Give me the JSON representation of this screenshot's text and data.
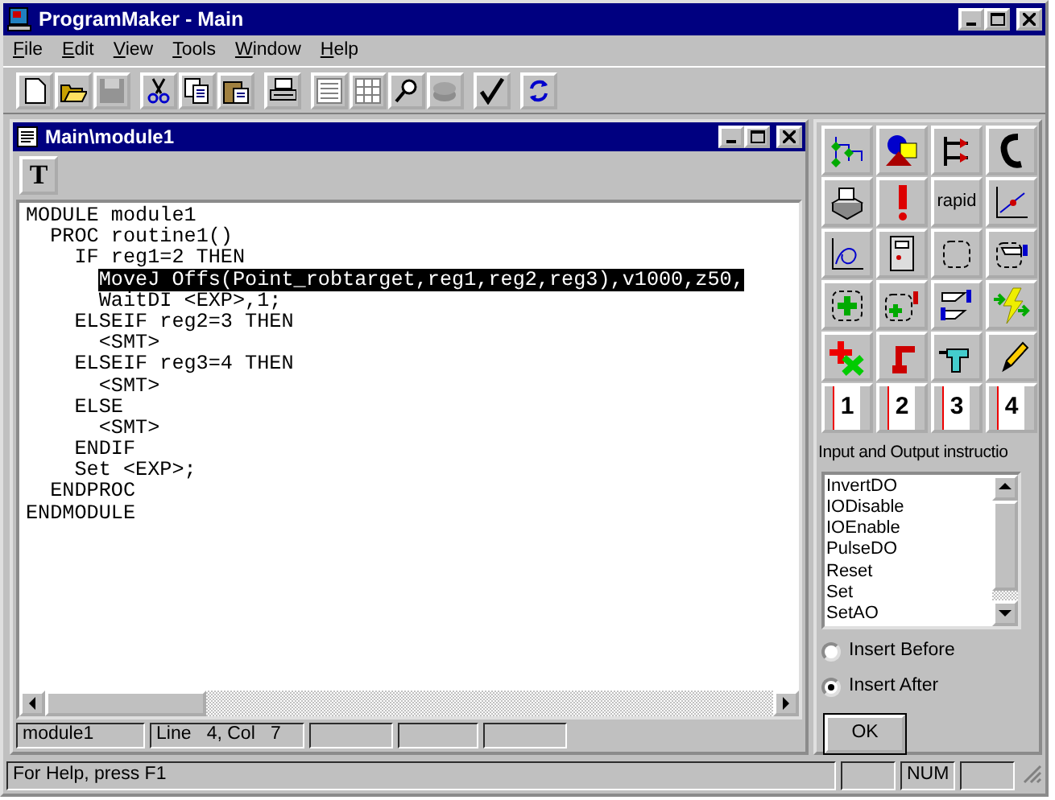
{
  "window": {
    "title": "ProgramMaker - Main"
  },
  "menu": [
    "File",
    "Edit",
    "View",
    "Tools",
    "Window",
    "Help"
  ],
  "toolbar": [
    [
      {
        "disabled": false
      },
      {
        "disabled": false
      },
      {
        "disabled": true
      }
    ],
    [
      {
        "disabled": false
      },
      {
        "disabled": false
      },
      {
        "disabled": false
      }
    ],
    [
      {
        "disabled": false
      }
    ],
    [
      {
        "disabled": false
      },
      {
        "disabled": false
      },
      {
        "disabled": false
      },
      {
        "disabled": true
      }
    ],
    [
      {
        "disabled": false
      }
    ],
    [
      {
        "disabled": false
      }
    ]
  ],
  "child_window": {
    "title": "Main\\module1",
    "tool_button": "T",
    "code_lines": [
      {
        "text": "MODULE module1",
        "selected": false
      },
      {
        "text": "  PROC routine1()",
        "selected": false
      },
      {
        "text": "    IF reg1=2 THEN",
        "selected": false
      },
      {
        "text": "      MoveJ Offs(Point_robtarget,reg1,reg2,reg3),v1000,z50,",
        "selected": true
      },
      {
        "text": "      WaitDI <EXP>,1;",
        "selected": false
      },
      {
        "text": "    ELSEIF reg2=3 THEN",
        "selected": false
      },
      {
        "text": "      <SMT>",
        "selected": false
      },
      {
        "text": "    ELSEIF reg3=4 THEN",
        "selected": false
      },
      {
        "text": "      <SMT>",
        "selected": false
      },
      {
        "text": "    ELSE",
        "selected": false
      },
      {
        "text": "      <SMT>",
        "selected": false
      },
      {
        "text": "    ENDIF",
        "selected": false
      },
      {
        "text": "    Set <EXP>;",
        "selected": false
      },
      {
        "text": "  ENDPROC",
        "selected": false
      },
      {
        "text": "ENDMODULE",
        "selected": false
      }
    ],
    "status_bar": {
      "module": "module1",
      "position": "Line   4, Col   7"
    }
  },
  "palette": {
    "buttons": [
      {
        "kind": "icon"
      },
      {
        "kind": "icon"
      },
      {
        "kind": "icon"
      },
      {
        "kind": "icon"
      },
      {
        "kind": "icon"
      },
      {
        "kind": "icon"
      },
      {
        "kind": "text",
        "label": "rapid"
      },
      {
        "kind": "icon"
      },
      {
        "kind": "icon"
      },
      {
        "kind": "icon"
      },
      {
        "kind": "icon"
      },
      {
        "kind": "icon"
      },
      {
        "kind": "icon"
      },
      {
        "kind": "icon"
      },
      {
        "kind": "icon"
      },
      {
        "kind": "icon"
      },
      {
        "kind": "icon"
      },
      {
        "kind": "icon"
      },
      {
        "kind": "icon"
      },
      {
        "kind": "icon"
      },
      {
        "kind": "number",
        "label": "1"
      },
      {
        "kind": "number",
        "label": "2"
      },
      {
        "kind": "number",
        "label": "3"
      },
      {
        "kind": "number",
        "label": "4"
      }
    ],
    "category": "Input and Output instructio",
    "instructions": [
      "InvertDO",
      "IODisable",
      "IOEnable",
      "PulseDO",
      "Reset",
      "Set",
      "SetAO"
    ],
    "insert_options": [
      {
        "label": "Insert Before",
        "selected": false
      },
      {
        "label": "Insert After",
        "selected": true
      }
    ],
    "ok_button": "OK"
  },
  "status_bar": {
    "message": "For Help, press F1",
    "indicators": [
      "NUM"
    ]
  }
}
